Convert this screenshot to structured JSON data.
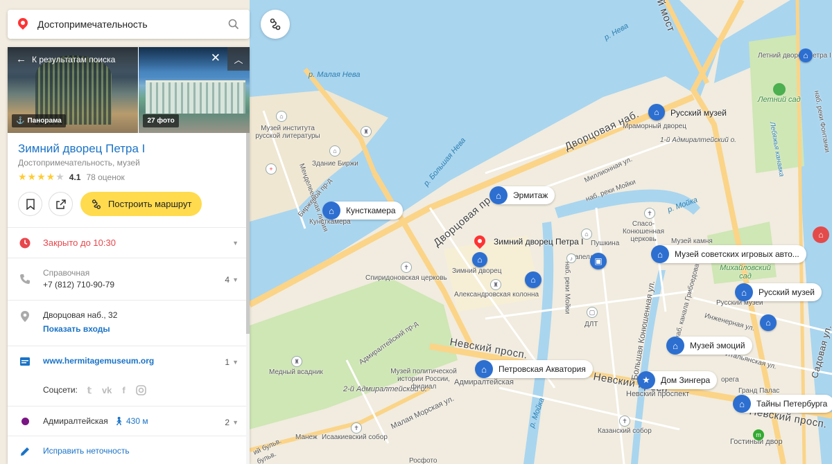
{
  "search": {
    "query": "Достопримечательность"
  },
  "card": {
    "back_label": "К результатам поиска",
    "photo_tags": {
      "panorama": "Панорама",
      "photos": "27 фото"
    },
    "title": "Зимний дворец Петра I",
    "subtitle": "Достопримечательность, музей",
    "rating": {
      "value": "4.1",
      "stars_filled": 4,
      "stars_total": 5,
      "count": "78 оценок"
    },
    "route_label": "Построить маршрут",
    "hours": "Закрыто до 10:30",
    "phone": {
      "label": "Справочная",
      "number": "+7 (812) 710-90-79",
      "count": "4"
    },
    "address": {
      "text": "Дворцовая наб., 32",
      "entrances": "Показать входы"
    },
    "website": {
      "url": "www.hermitagemuseum.org",
      "count": "1"
    },
    "social_label": "Соцсети:",
    "metro": {
      "name": "Адмиралтейская",
      "walk": "430 м",
      "count": "2",
      "line_color": "#7a1584"
    },
    "fix_label": "Исправить неточность"
  },
  "map": {
    "colors": {
      "water": "#a9d5ef",
      "land": "#f1ecdf",
      "road": "#fbd488",
      "park": "#cfe6b5",
      "marker": "#f33",
      "poi": "#2d6fd0"
    },
    "pills": {
      "kunstkamera": "Кунсткамера",
      "hermitage": "Эрмитаж",
      "russian_museum_1": "Русский музей",
      "russian_museum_2": "Русский музей",
      "soviet_games": "Музей советских игровых авто...",
      "emotions": "Музей эмоций",
      "petrovskaya": "Петровская Акватория",
      "singer": "Дом Зингера",
      "secrets": "Тайны Петербурга"
    },
    "selected_label": "Зимний дворец Петра I",
    "labels": {
      "neva": "р. Нева",
      "malaya_neva": "р. Малая Нева",
      "bolshaya_neva": "р. Большая Нева",
      "moika1": "р. Мойка",
      "moika2": "наб. реки Мойки",
      "moika3": "р. Мойка",
      "fontanka": "наб. реки Фонтанки",
      "dvortsovaya_nab": "Дворцовая наб.",
      "dvortsovaya_pr": "Дворцовая пр.",
      "nevsky1": "Невский просп.",
      "nevsky2": "Невский просп.",
      "nevsky3": "Невский просп.",
      "millionnaya": "Миллионная ул.",
      "mariy_most": "ий мост",
      "letniy_sad": "Летний сад",
      "letniy_dvorets": "Летний дворец Петра I",
      "mikhailovsky": "Михайловский сад",
      "mramorny": "Мраморный дворец",
      "adm_island_1": "1-й Адмиралтейский о.",
      "adm_island_2": "2-й Адмиралтейский о.",
      "zimniy_dvorets": "Зимний дворец",
      "alex_column": "Александровская колонна",
      "spiridon": "Спиридоновская церковь",
      "birzha": "Здание Биржи",
      "mus_lit": "Музей института русской литературы",
      "birzhevoy": "Биржевой пр-д",
      "kunst_small": "Кунсткамера",
      "lineya": "Менделеевская линия",
      "admiralteysky_pr": "Адмиралтейский пр-д",
      "medny": "Медный всадник",
      "mus_polit": "Музей политической истории России, филиал",
      "admiralteyskaya": "Адмиралтейская",
      "malaya_morskaya": "Малая Морская ул.",
      "manezh": "Манеж",
      "isaac": "Исаакиевский собор",
      "rosfoto": "Росфото",
      "kazansky": "Казанский собор",
      "gostiny": "Гостиный двор",
      "nevsky_prospekt_st": "Невский проспект",
      "grand_palas": "Гранд Палас",
      "inzhenernaya": "Инженерная ул.",
      "italyanskaya": "Итальянская ул.",
      "sadovaya": "Садовая ул.",
      "konyushennaya": "Большая Конюшенная ул.",
      "griboedova": "наб. канала Грибоедова",
      "spas": "Спасо-Конюшенная церковь",
      "pushkina": "Пушкина",
      "kapella": "Капелла",
      "muz_kamnya": "Музей камня",
      "russkiy_muzey_small": "Русский музей",
      "lebyazhya": "Лебяжья канавка",
      "dlt": "ДЛТ",
      "orega": "орега",
      "admir_bulv": "ий бульв.",
      "bulv2": "бульв."
    }
  }
}
